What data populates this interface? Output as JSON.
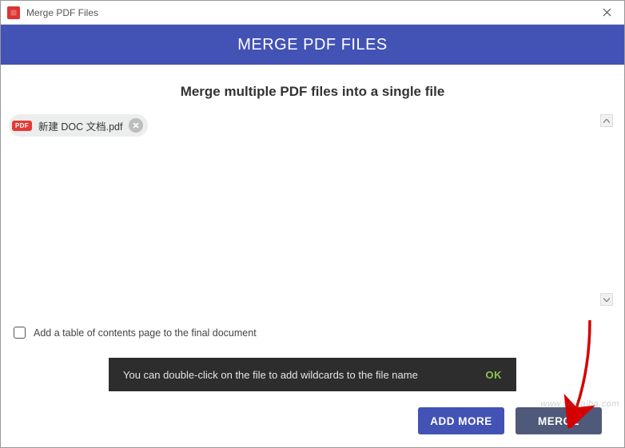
{
  "window": {
    "title": "Merge PDF Files"
  },
  "header": {
    "title": "MERGE PDF FILES"
  },
  "main": {
    "subtitle": "Merge multiple PDF files into a single file",
    "files": [
      {
        "badge": "PDF",
        "name": "新建 DOC 文档.pdf"
      }
    ],
    "toc_label": "Add a table of contents page to the final document",
    "toc_checked": false
  },
  "toast": {
    "message": "You can double-click on the file to add wildcards to the file name",
    "ok_label": "OK"
  },
  "footer": {
    "add_more_label": "ADD MORE",
    "merge_label": "MERGE"
  },
  "watermark": "www.xiazaiba.com",
  "colors": {
    "accent": "#4352b5",
    "merge_btn": "#4f5a7a",
    "toast_bg": "#2d2d2d",
    "toast_ok": "#8bc34a",
    "pdf_badge": "#e53935"
  }
}
